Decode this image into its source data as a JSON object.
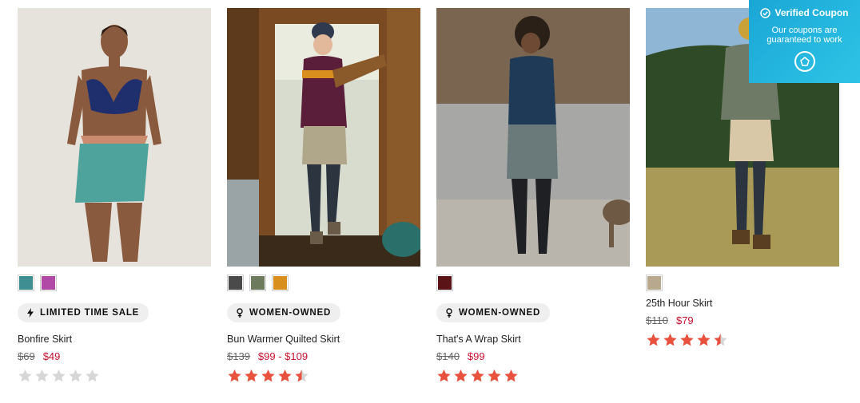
{
  "products": [
    {
      "name": "Bonfire Skirt",
      "badge": "LIMITED TIME SALE",
      "badge_icon": "lightning-icon",
      "price_was": "$69",
      "price_now": "$49",
      "rating": 0,
      "swatches": [
        "#3f8e92",
        "#b04aa6"
      ]
    },
    {
      "name": "Bun Warmer Quilted Skirt",
      "badge": "WOMEN-OWNED",
      "badge_icon": "female-icon",
      "price_was": "$139",
      "price_now": "$99 - $109",
      "rating": 4.5,
      "swatches": [
        "#4a4a4a",
        "#6e7a5c",
        "#d98f1e"
      ]
    },
    {
      "name": "That's A Wrap Skirt",
      "badge": "WOMEN-OWNED",
      "badge_icon": "female-icon",
      "price_was": "$140",
      "price_now": "$99",
      "rating": 5,
      "swatches": [
        "#5a1418"
      ]
    },
    {
      "name": "25th Hour Skirt",
      "badge": "",
      "badge_icon": "",
      "price_was": "$110",
      "price_now": "$79",
      "rating": 4.5,
      "swatches": [
        "#b8a88e"
      ]
    }
  ],
  "coupon": {
    "title": "Verified Coupon",
    "subtitle_line1": "Our coupons are",
    "subtitle_line2": "guaranteed to work"
  },
  "colors": {
    "sale": "#c8102e",
    "star": "#e8513e",
    "star_empty": "#d6d6d6",
    "coupon": "#1aa6d6"
  }
}
